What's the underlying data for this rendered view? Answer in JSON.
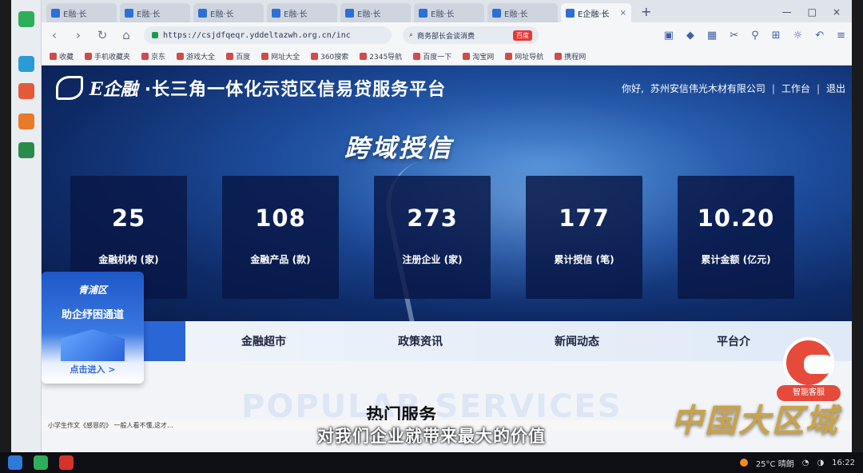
{
  "browser": {
    "tabs": [
      {
        "label": "E融·长",
        "active": false
      },
      {
        "label": "E融·长",
        "active": false
      },
      {
        "label": "E融·长",
        "active": false
      },
      {
        "label": "E融·长",
        "active": false
      },
      {
        "label": "E融·长",
        "active": false
      },
      {
        "label": "E融·长",
        "active": false
      },
      {
        "label": "E融·长",
        "active": false
      },
      {
        "label": "E企融·长",
        "active": true
      }
    ],
    "url": "https://csjdfqeqr.yddeltazwh.org.cn/inc",
    "search_text": "商务部长会谈消费",
    "search_badge": "百度",
    "bookmarks": [
      "收藏",
      "手机收藏夹",
      "京东",
      "游戏大全",
      "百度",
      "网址大全",
      "360搜索",
      "2345导航",
      "百度一下",
      "淘宝网",
      "网址导航",
      "携程网"
    ]
  },
  "site": {
    "brand": "E企融",
    "title": "·长三角一体化示范区信易贷服务平台",
    "greeting": "你好,",
    "company": "苏州安信伟光木材有限公司",
    "workbench": "工作台",
    "logout": "退出",
    "hero_heading": "跨域授信",
    "stats": [
      {
        "value": "25",
        "label": "金融机构 (家)"
      },
      {
        "value": "108",
        "label": "金融产品 (款)"
      },
      {
        "value": "273",
        "label": "注册企业 (家)"
      },
      {
        "value": "177",
        "label": "累计授信 (笔)"
      },
      {
        "value": "10.20",
        "label": "累计金额 (亿元)"
      }
    ],
    "promo": {
      "region": "青浦区",
      "title": "助企纾困通道",
      "cta": "点击进入 >"
    },
    "nav": [
      "金融超市",
      "政策资讯",
      "新闻动态",
      "平台介"
    ],
    "popular_bg": "POPULAR SERVICES",
    "popular_title": "热门服务",
    "robot_tag": "智能客服"
  },
  "status_line": "小学生作文《感恩的》 一般人看不懂,这才...",
  "taskbar": {
    "weather": "25°C 晴朗",
    "clock": "16:22"
  },
  "overlay": {
    "subtitle": "对我们企业就带来最大的价值",
    "watermark": "中国大区域"
  },
  "colors": {
    "hero_dark": "#0e2a66",
    "accent": "#2a66d6",
    "robot": "#e64a3b",
    "watermark": "#c9a24a"
  }
}
